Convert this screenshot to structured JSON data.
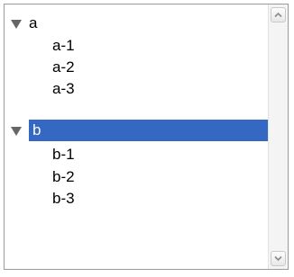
{
  "tree": {
    "nodes": [
      {
        "label": "a",
        "expanded": true,
        "selected": false,
        "children": [
          {
            "label": "a-1"
          },
          {
            "label": "a-2"
          },
          {
            "label": "a-3"
          }
        ]
      },
      {
        "label": "b",
        "expanded": true,
        "selected": true,
        "children": [
          {
            "label": "b-1"
          },
          {
            "label": "b-2"
          },
          {
            "label": "b-3"
          }
        ]
      }
    ]
  },
  "icons": {
    "toggle": "triangle-down-icon",
    "scroll_up": "chevron-up-icon",
    "scroll_down": "chevron-down-icon"
  },
  "colors": {
    "selection": "#3468c2",
    "toggle": "#666666",
    "border": "#9a9a9a"
  }
}
